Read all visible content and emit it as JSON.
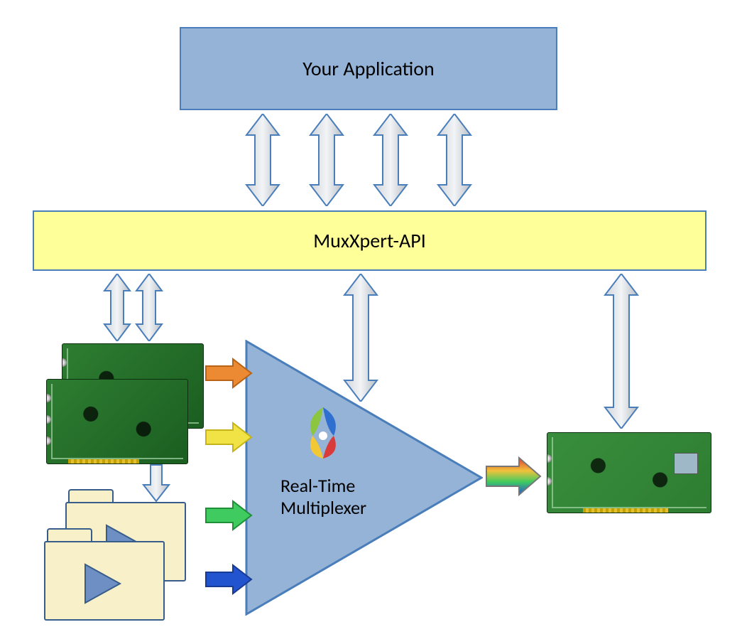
{
  "app": {
    "label": "Your Application"
  },
  "api": {
    "label": "MuxXpert-API"
  },
  "mux": {
    "line1": "Real-Time",
    "line2": "Multiplexer"
  },
  "arrows": {
    "input_colors": [
      "#EC8A34",
      "#F1E245",
      "#3FCB5F",
      "#2354CF"
    ],
    "output_gradient": [
      "#E23B30",
      "#F1C23B",
      "#3FCB5F",
      "#2354CF"
    ]
  },
  "components": {
    "input_cards": "pci-input-cards",
    "output_card": "pci-output-card",
    "folders": "media-folders"
  }
}
